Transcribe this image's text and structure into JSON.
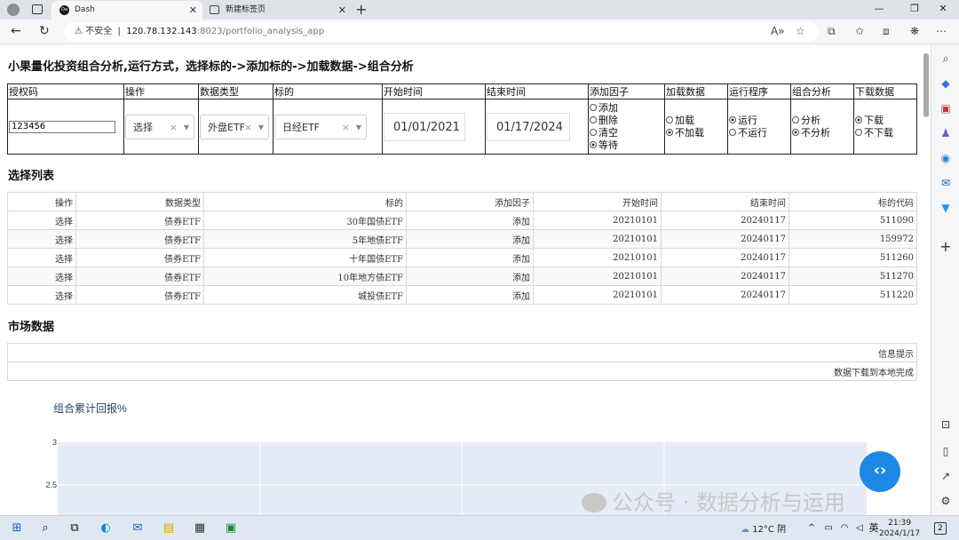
{
  "browser": {
    "tabs": [
      {
        "title": "Dash",
        "favicon": "Dash",
        "active": true
      },
      {
        "title": "新建标签页",
        "active": false
      }
    ],
    "url_warning": "不安全",
    "url_host": "120.78.132.143",
    "url_path": ":8023/portfolio_analysis_app"
  },
  "page": {
    "title": "小果量化投资组合分析,运行方式，选择标的->添加标的->加载数据->组合分析",
    "controls": {
      "headers": [
        "授权码",
        "操作",
        "数据类型",
        "标的",
        "开始时间",
        "结束时间",
        "添加因子",
        "加载数据",
        "运行程序",
        "组合分析",
        "下载数据"
      ],
      "auth_code": "123456",
      "operation": "选择",
      "data_type": "外盘ETF",
      "symbol": "日经ETF",
      "start_date": "01/01/2021",
      "end_date": "01/17/2024",
      "add_factor": [
        {
          "label": "添加",
          "checked": false
        },
        {
          "label": "删除",
          "checked": false
        },
        {
          "label": "清空",
          "checked": false
        },
        {
          "label": "等待",
          "checked": true
        }
      ],
      "load_data": [
        {
          "label": "加载",
          "checked": false
        },
        {
          "label": "不加载",
          "checked": true
        }
      ],
      "run_program": [
        {
          "label": "运行",
          "checked": true
        },
        {
          "label": "不运行",
          "checked": false
        }
      ],
      "portfolio": [
        {
          "label": "分析",
          "checked": false
        },
        {
          "label": "不分析",
          "checked": true
        }
      ],
      "download": [
        {
          "label": "下载",
          "checked": true
        },
        {
          "label": "不下载",
          "checked": false
        }
      ]
    },
    "selection_title": "选择列表",
    "selection_table": {
      "columns": [
        "操作",
        "数据类型",
        "标的",
        "添加因子",
        "开始时间",
        "结束时间",
        "标的代码"
      ],
      "rows": [
        [
          "选择",
          "债券ETF",
          "30年国债ETF",
          "添加",
          "20210101",
          "20240117",
          "511090"
        ],
        [
          "选择",
          "债券ETF",
          "5年地债ETF",
          "添加",
          "20210101",
          "20240117",
          "159972"
        ],
        [
          "选择",
          "债券ETF",
          "十年国债ETF",
          "添加",
          "20210101",
          "20240117",
          "511260"
        ],
        [
          "选择",
          "债券ETF",
          "10年地方债ETF",
          "添加",
          "20210101",
          "20240117",
          "511270"
        ],
        [
          "选择",
          "债券ETF",
          "城投债ETF",
          "添加",
          "20210101",
          "20240117",
          "511220"
        ]
      ]
    },
    "market_title": "市场数据",
    "market_table": {
      "header": "信息提示",
      "message": "数据下载到本地完成"
    },
    "watermark": "公众号 · 数据分析与运用"
  },
  "chart_data": {
    "type": "line",
    "title": "组合累计回报%",
    "yticks": [
      "3",
      "2.5"
    ],
    "series": []
  },
  "taskbar": {
    "weather": "12°C 阴",
    "ime": "英",
    "time": "21:39",
    "date": "2024/1/17",
    "notifications": "2"
  },
  "colors": {
    "accent": "#1e88e5",
    "plot_bg": "#e5ecf6"
  }
}
